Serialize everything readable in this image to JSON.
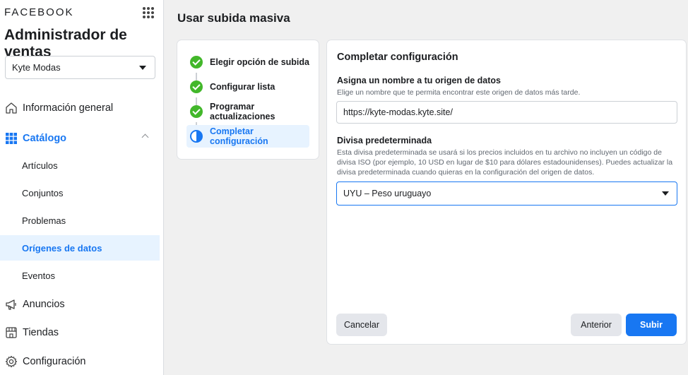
{
  "sidebar": {
    "brand": "FACEBOOK",
    "app_title": "Administrador de ventas",
    "account": "Kyte Modas",
    "nav": {
      "overview": "Información general",
      "catalog": "Catálogo",
      "catalog_items": [
        "Artículos",
        "Conjuntos",
        "Problemas",
        "Orígenes de datos",
        "Eventos"
      ],
      "ads": "Anuncios",
      "shops": "Tiendas",
      "settings": "Configuración"
    }
  },
  "page": {
    "title": "Usar subida masiva"
  },
  "steps": [
    {
      "label": "Elegir opción de subida",
      "status": "done"
    },
    {
      "label": "Configurar lista",
      "status": "done"
    },
    {
      "label": "Programar actualizaciones",
      "status": "done"
    },
    {
      "label": "Completar configuración",
      "status": "current"
    }
  ],
  "config": {
    "title": "Completar configuración",
    "name_label": "Asigna un nombre a tu origen de datos",
    "name_help": "Elige un nombre que te permita encontrar este origen de datos más tarde.",
    "name_value": "https://kyte-modas.kyte.site/",
    "currency_label": "Divisa predeterminada",
    "currency_help": "Esta divisa predeterminada se usará si los precios incluidos en tu archivo no incluyen un código de divisa ISO (por ejemplo, 10 USD en lugar de $10 para dólares estadounidenses). Puedes actualizar la divisa predeterminada cuando quieras en la configuración del origen de datos.",
    "currency_value": "UYU – Peso uruguayo"
  },
  "buttons": {
    "cancel": "Cancelar",
    "previous": "Anterior",
    "upload": "Subir"
  },
  "colors": {
    "accent": "#1877f2",
    "success": "#42b72a",
    "active_bg": "#e7f3ff"
  }
}
